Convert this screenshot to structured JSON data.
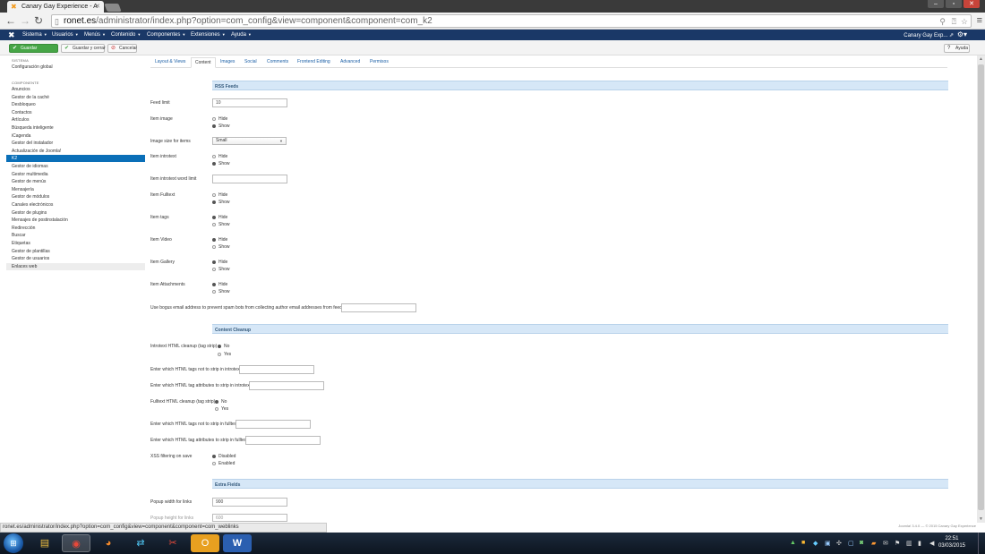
{
  "browser": {
    "tab_title": "Canary Gay Experience - A",
    "url_host": "ronet.es",
    "url_path": "/administrator/index.php?option=com_config&view=component&component=com_k2",
    "status_url": "ronet.es/administrator/index.php?option=com_config&view=component&component=com_weblinks"
  },
  "nav": {
    "items": [
      "Sistema",
      "Usuarios",
      "Menús",
      "Contenido",
      "Componentes",
      "Extensiones",
      "Ayuda"
    ],
    "site_name": "Canary Gay Exp..."
  },
  "toolbar": {
    "save": "Guardar",
    "save_close": "Guardar y cerrar",
    "cancel": "Cancelar",
    "help": "Ayuda"
  },
  "sidebar": {
    "system_heading": "SISTEMA",
    "global_config": "Configuración global",
    "components_heading": "COMPONENTE",
    "items": [
      "Anuncios",
      "Gestor de la caché",
      "Desbloqueo",
      "Contactos",
      "Artículos",
      "Búsqueda inteligente",
      "iCagenda",
      "Gestor del instalador",
      "Actualización de Joomla!",
      "K2",
      "Gestor de idiomas",
      "Gestor multimedia",
      "Gestor de menús",
      "Mensajería",
      "Gestor de módulos",
      "Canales electrónicos",
      "Gestor de plugins",
      "Mensajes de postinstalación",
      "Redirección",
      "Buscar",
      "Etiquetas",
      "Gestor de plantillas",
      "Gestor de usuarios",
      "Enlaces web"
    ],
    "active_index": 9
  },
  "tabs": [
    "Layout & Views",
    "Content",
    "Images",
    "Social",
    "Comments",
    "Frontend Editing",
    "Advanced",
    "Permisos"
  ],
  "active_tab": 1,
  "sections": {
    "rss": "RSS Feeds",
    "cleanup": "Content Cleanup",
    "extra": "Extra Fields"
  },
  "options": {
    "hide": "Hide",
    "show": "Show",
    "no": "No",
    "yes": "Yes",
    "disabled": "Disabled",
    "enabled": "Enabled"
  },
  "rss_fields": {
    "feed_limit_label": "Feed limit",
    "feed_limit_value": "10",
    "item_image_label": "Item image",
    "image_size_label": "Image size for items",
    "image_size_value": "Small",
    "item_introtext_label": "Item introtext",
    "introtext_word_limit_label": "Item introtext word limit",
    "item_fulltext_label": "Item Fulltext",
    "item_tags_label": "Item tags",
    "item_video_label": "Item Video",
    "item_gallery_label": "Item Gallery",
    "item_attachments_label": "Item Attachments",
    "bogus_email_label": "Use bogus email address to prevent spam bots from collecting author email addresses from feeds"
  },
  "cleanup_fields": {
    "introtext_cleanup_label": "Introtext HTML cleanup (tag strip)",
    "introtext_tags_label": "Enter which HTML tags not to strip in introtext",
    "introtext_attrs_label": "Enter which HTML tag attributes to strip in introtext",
    "fulltext_cleanup_label": "Fulltext HTML cleanup (tag strip)",
    "fulltext_tags_label": "Enter which HTML tags not to strip in fulltext",
    "fulltext_attrs_label": "Enter which HTML tag attributes to strip in fulltext",
    "xss_label": "XSS filtering on save"
  },
  "extra_fields": {
    "popup_width_label": "Popup width for links",
    "popup_width_value": "900",
    "popup_height_label": "Popup height for links",
    "popup_height_value": "600"
  },
  "footer": "Joomla! 3.4.0 — © 2015 Canary Gay Experience",
  "taskbar": {
    "time": "22:51",
    "date": "03/03/2015"
  }
}
